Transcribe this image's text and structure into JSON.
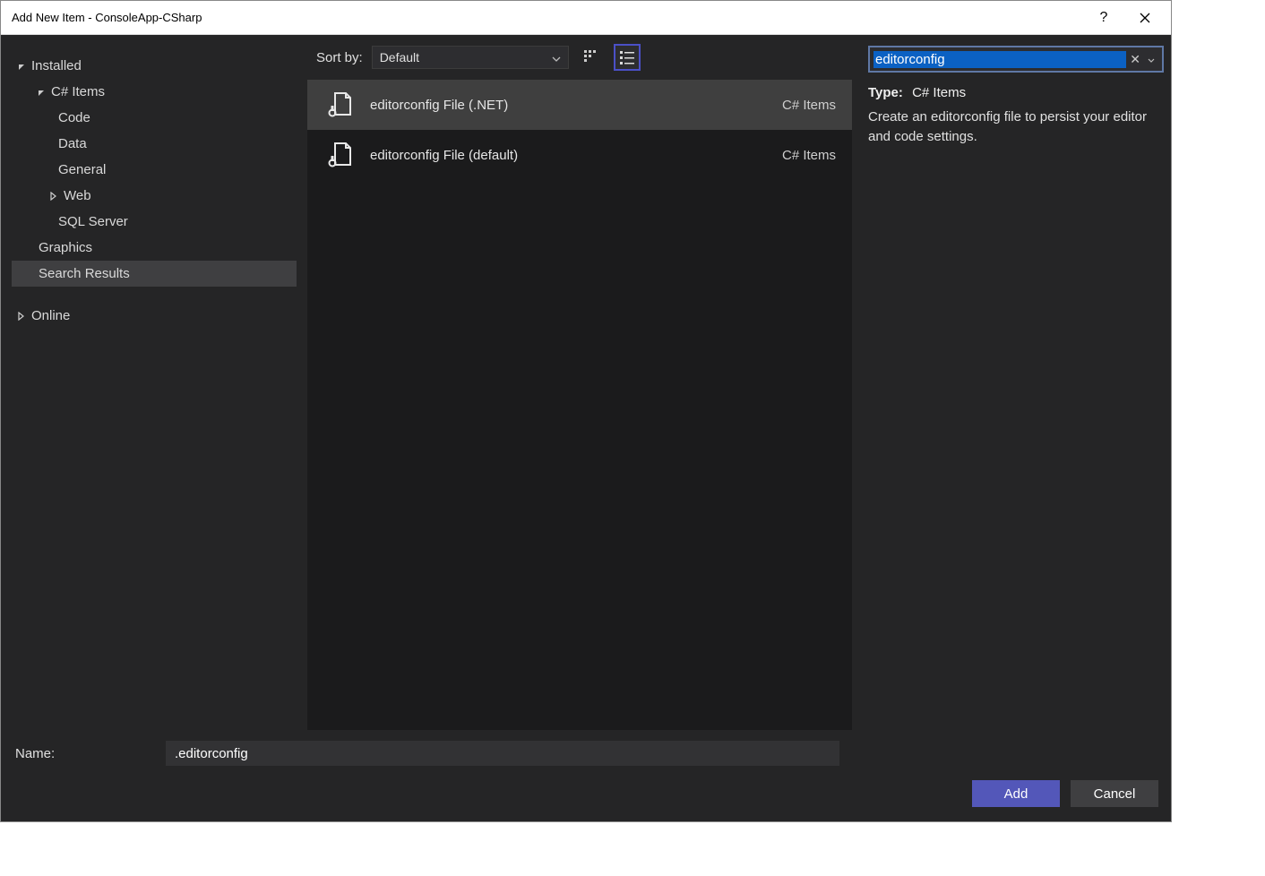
{
  "window": {
    "title": "Add New Item - ConsoleApp-CSharp"
  },
  "sidebar": {
    "installed_label": "Installed",
    "csharp_items_label": "C# Items",
    "items": {
      "code": "Code",
      "data": "Data",
      "general": "General",
      "web": "Web",
      "sqlserver": "SQL Server"
    },
    "graphics_label": "Graphics",
    "search_results_label": "Search Results",
    "online_label": "Online"
  },
  "toolbar": {
    "sort_label": "Sort by:",
    "sort_value": "Default"
  },
  "templates": [
    {
      "name": "editorconfig File (.NET)",
      "category": "C# Items",
      "selected": true
    },
    {
      "name": "editorconfig File (default)",
      "category": "C# Items",
      "selected": false
    }
  ],
  "search": {
    "value": "editorconfig"
  },
  "details": {
    "type_label": "Type:",
    "type_value": "C# Items",
    "description": "Create an editorconfig file to persist your editor and code settings."
  },
  "name_field": {
    "label": "Name:",
    "value": ".editorconfig"
  },
  "buttons": {
    "add": "Add",
    "cancel": "Cancel"
  }
}
